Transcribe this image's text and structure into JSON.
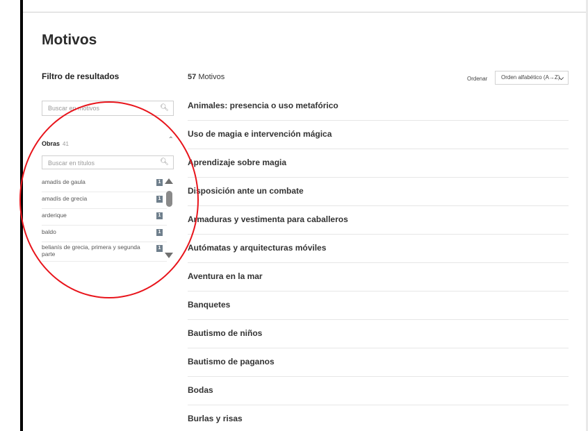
{
  "page": {
    "title": "Motivos"
  },
  "filter": {
    "title": "Filtro de resultados",
    "search_placeholder": "Buscar en motivos",
    "obras": {
      "label": "Obras",
      "count": "41",
      "search_placeholder": "Buscar en títulos",
      "items": [
        {
          "name": "amadís de gaula",
          "count": "1"
        },
        {
          "name": "amadís de grecia",
          "count": "1"
        },
        {
          "name": "arderique",
          "count": "1"
        },
        {
          "name": "baldo",
          "count": "1"
        },
        {
          "name": "belianís de grecia, primera y segunda parte",
          "count": "1"
        }
      ]
    }
  },
  "results": {
    "count": "57",
    "count_label": "Motivos",
    "sort_label": "Ordenar",
    "sort_value": "Orden alfabético (A→Z)",
    "items": [
      "Animales: presencia o uso metafórico",
      "Uso de magia e intervención mágica",
      "Aprendizaje sobre magia",
      "Disposición ante un combate",
      "Armaduras y vestimenta para caballeros",
      "Autómatas y arquitecturas móviles",
      "Aventura en la mar",
      "Banquetes",
      "Bautismo de niños",
      "Bautismo de paganos",
      "Bodas",
      "Burlas y risas"
    ]
  },
  "annotation": {
    "color": "#e8141b"
  }
}
